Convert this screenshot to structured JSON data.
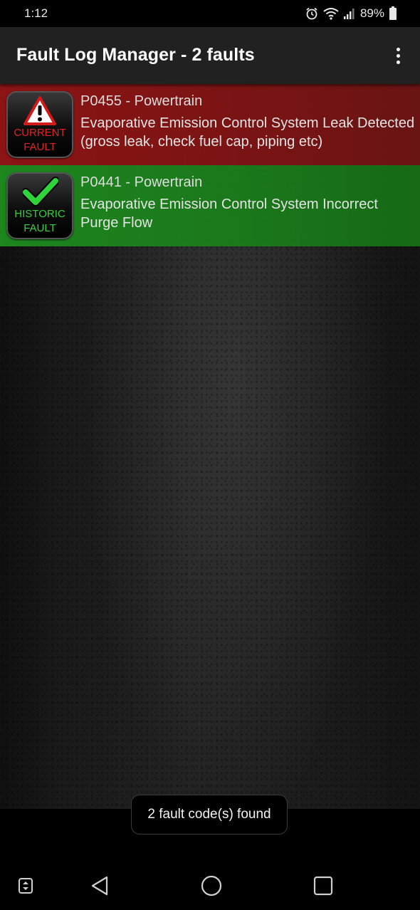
{
  "status_bar": {
    "time": "1:12",
    "battery_percent": "89%",
    "icons": [
      "alarm-icon",
      "wifi-icon",
      "signal-icon",
      "battery-icon"
    ]
  },
  "toolbar": {
    "title": "Fault Log Manager - 2 faults",
    "menu_icon": "overflow-menu-icon"
  },
  "faults": [
    {
      "status": "current",
      "badge_line1": "CURRENT",
      "badge_line2": "FAULT",
      "badge_icon": "warning-triangle-icon",
      "code": "P0455 - Powertrain",
      "description": "Evaporative Emission Control System Leak Detected (gross leak, check fuel cap, piping etc)",
      "color": "#961414"
    },
    {
      "status": "historic",
      "badge_line1": "HISTORIC",
      "badge_line2": "FAULT",
      "badge_icon": "checkmark-icon",
      "code": "P0441 - Powertrain",
      "description": "Evaporative Emission Control System Incorrect Purge Flow",
      "color": "#1e8c1e"
    }
  ],
  "toast": {
    "message": "2 fault code(s) found"
  },
  "nav_bar": {
    "buttons": [
      "keyboard-toggle-icon",
      "back-icon",
      "home-icon",
      "recents-icon"
    ]
  }
}
